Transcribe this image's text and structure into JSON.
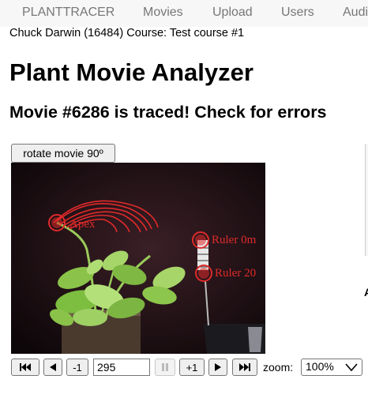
{
  "nav": {
    "brand": "PLANTTRACER",
    "items": [
      {
        "label": "Movies"
      },
      {
        "label": "Upload"
      },
      {
        "label": "Users"
      },
      {
        "label": "Audi"
      }
    ]
  },
  "user_line": "Chuck Darwin (16484) Course: Test course #1",
  "page_title": "Plant Movie Analyzer",
  "movie_status": "Movie #6286 is traced! Check for errors",
  "rotate_button": "rotate movie 90º",
  "viewer": {
    "markers": [
      {
        "label": "Apex"
      },
      {
        "label": "Ruler 0m"
      },
      {
        "label": "Ruler 20"
      }
    ],
    "marker_color": "#e02a2a",
    "trace_color": "#e02a2a"
  },
  "controls": {
    "first_icon": "skip-to-start-icon",
    "prev_icon": "step-back-icon",
    "minus_one": "-1",
    "frame_number": "295",
    "pause_icon": "pause-icon",
    "plus_one": "+1",
    "next_icon": "step-forward-icon",
    "last_icon": "skip-to-end-icon",
    "zoom_label": "zoom:",
    "zoom_value": "100%"
  },
  "right_partial_letter": "A"
}
